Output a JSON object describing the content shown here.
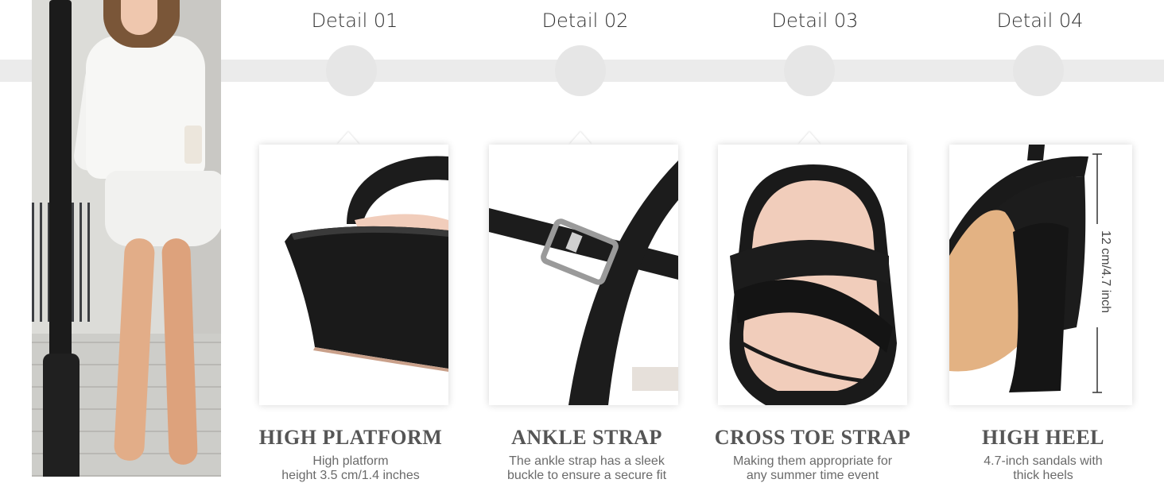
{
  "details": [
    {
      "label": "Detail 01",
      "title": "HIGH PLATFORM",
      "desc_lines": [
        "High platform",
        "height 3.5 cm/1.4 inches"
      ]
    },
    {
      "label": "Detail 02",
      "title": "ANKLE STRAP",
      "desc_lines": [
        "The ankle strap has a sleek",
        "buckle to ensure a secure fit"
      ]
    },
    {
      "label": "Detail 03",
      "title": "CROSS TOE STRAP",
      "desc_lines": [
        "Making them appropriate for",
        "any summer time event"
      ]
    },
    {
      "label": "Detail 04",
      "title": "HIGH HEEL",
      "desc_lines": [
        "4.7-inch sandals with",
        "thick heels"
      ]
    }
  ],
  "heel_measure": "12 cm/4.7 inch",
  "colors": {
    "band": "#ebebeb",
    "dot": "#e6e6e6",
    "title": "#555555",
    "text": "#6a6a6a",
    "leather": "#1c1c1c",
    "insole": "#f1cdbb"
  }
}
